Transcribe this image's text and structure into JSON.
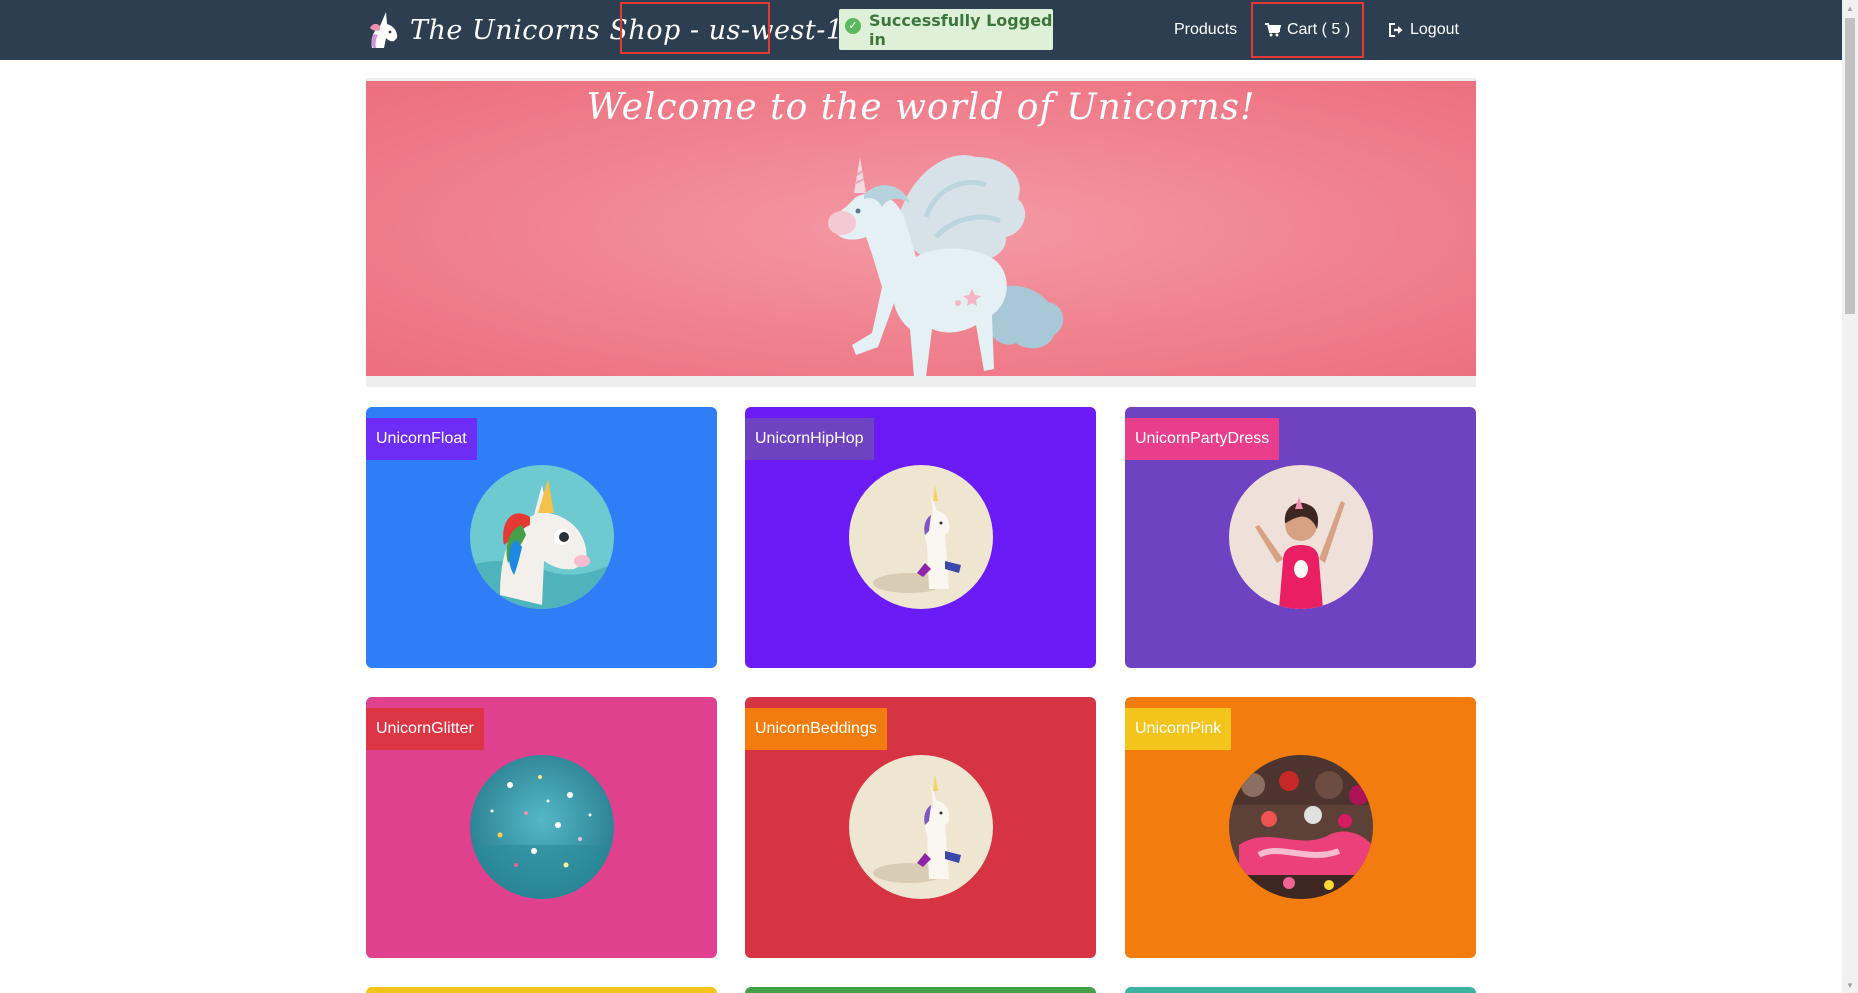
{
  "navbar": {
    "brand_title": "The Unicorns Shop - us-west-1",
    "alert": "Successfully Logged in",
    "products": "Products",
    "cart": "Cart ( 5 )",
    "logout": "Logout"
  },
  "hero": {
    "title": "Welcome to the world of Unicorns!"
  },
  "products": [
    {
      "name": "UnicornFloat",
      "bg": "#2f7ef7",
      "tag": "#6e2cf7"
    },
    {
      "name": "UnicornHipHop",
      "bg": "#6b1cf6",
      "tag": "#6f42c1"
    },
    {
      "name": "UnicornPartyDress",
      "bg": "#6f42c1",
      "tag": "#e83e8c"
    },
    {
      "name": "UnicornGlitter",
      "bg": "#e0418f",
      "tag": "#dc3545"
    },
    {
      "name": "UnicornBeddings",
      "bg": "#d63343",
      "tag": "#f27c0d"
    },
    {
      "name": "UnicornPink",
      "bg": "#f27c0d",
      "tag": "#f3c41b"
    }
  ],
  "colors": {
    "navbar": "#2c3e50",
    "alert_bg": "#dff0d8",
    "alert_text": "#3c763d",
    "highlight": "#e53935",
    "hero_bg": "#ef7a88"
  },
  "icons": {
    "brand": "unicorn-head-icon",
    "alert": "check-circle-icon",
    "cart": "shopping-cart-icon",
    "logout": "sign-out-icon"
  }
}
